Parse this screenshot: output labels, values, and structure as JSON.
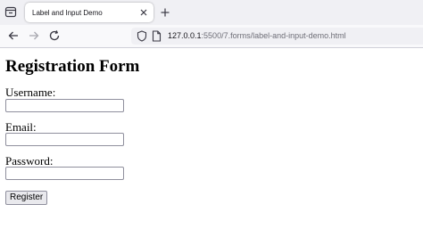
{
  "browser": {
    "tab_title": "Label and Input Demo",
    "url_host": "127.0.0.1",
    "url_path": ":5500/7.forms/label-and-input-demo.html",
    "icons": {
      "tab_list": "tab-list-icon",
      "tab_close": "close-icon",
      "new_tab": "plus-icon",
      "back": "back-arrow-icon",
      "forward": "forward-arrow-icon",
      "reload": "reload-icon",
      "tracking": "shield-icon",
      "page_info": "page-icon"
    }
  },
  "page": {
    "heading": "Registration Form",
    "username_label": "Username:",
    "username_value": "",
    "email_label": "Email:",
    "email_value": "",
    "password_label": "Password:",
    "password_value": "",
    "submit_label": "Register"
  }
}
